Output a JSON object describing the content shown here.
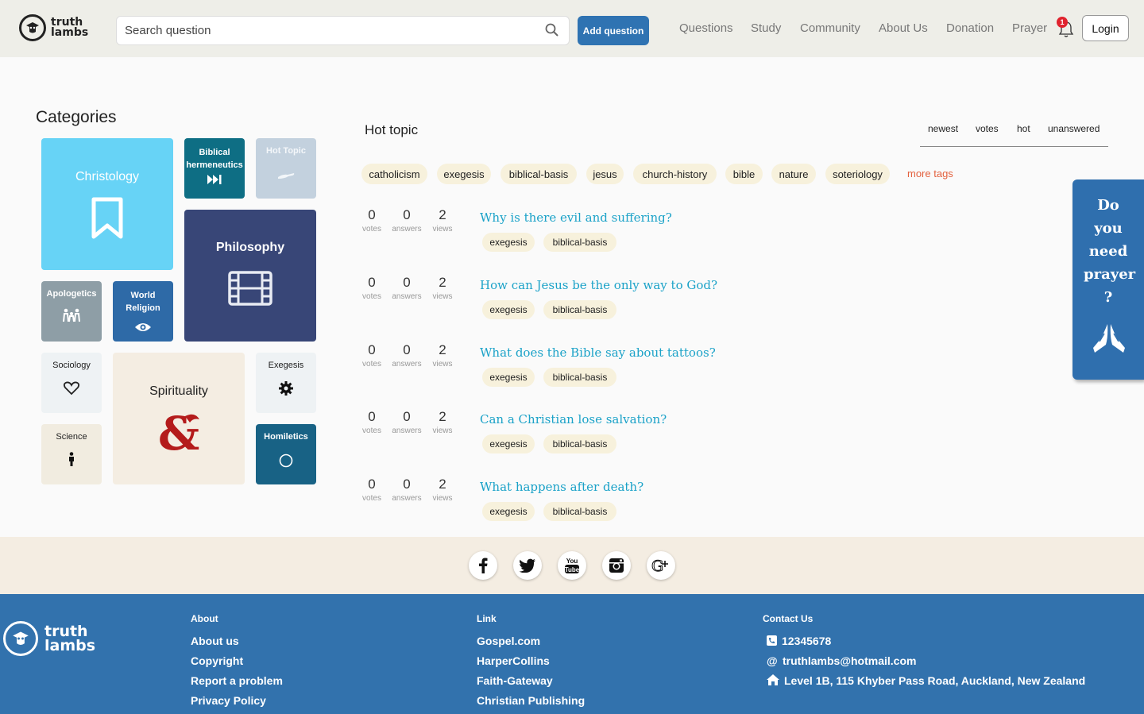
{
  "brand": {
    "line1": "truth",
    "line2": "lambs"
  },
  "search": {
    "placeholder": "Search question"
  },
  "header": {
    "add_question": "Add question",
    "nav": [
      "Questions",
      "Study",
      "Community",
      "About Us",
      "Donation",
      "Prayer"
    ],
    "notification_count": "1",
    "login": "Login"
  },
  "categories": {
    "title": "Categories",
    "tiles": [
      {
        "label": "Christology",
        "icon": "bookmark-icon",
        "color": "#67d3f6"
      },
      {
        "label": "Biblical hermeneutics",
        "icon": "fast-forward-icon",
        "color": "#0e6e84"
      },
      {
        "label": "Hot Topic",
        "icon": "hand-icon",
        "color": "#c3d1de"
      },
      {
        "label": "Philosophy",
        "icon": "film-icon",
        "color": "#384677"
      },
      {
        "label": "Apologetics",
        "icon": "people-icon",
        "color": "#8e9ea6"
      },
      {
        "label": "World Religion",
        "icon": "eye-icon",
        "color": "#2e6aa7"
      },
      {
        "label": "Sociology",
        "icon": "heart-icon",
        "color": "#eef2f4"
      },
      {
        "label": "Spirituality",
        "icon": "ampersand-dragon-icon",
        "color": "#f4ede2"
      },
      {
        "label": "Exegesis",
        "icon": "gear-icon",
        "color": "#eef2f4"
      },
      {
        "label": "Science",
        "icon": "person-icon",
        "color": "#f1ece0"
      },
      {
        "label": "Homiletics",
        "icon": "circle-icon",
        "color": "#186285"
      }
    ]
  },
  "hot": {
    "title": "Hot topic",
    "sort": [
      "newest",
      "votes",
      "hot",
      "unanswered"
    ],
    "tags": [
      "catholicism",
      "exegesis",
      "biblical-basis",
      "jesus",
      "church-history",
      "bible",
      "nature",
      "soteriology"
    ],
    "more_tags": "more tags"
  },
  "stat_labels": {
    "votes": "votes",
    "answers": "answers",
    "views": "views"
  },
  "questions": [
    {
      "title": "Why is there evil and suffering?",
      "votes": "0",
      "answers": "0",
      "views": "2",
      "tags": [
        "exegesis",
        "biblical-basis"
      ]
    },
    {
      "title": "How can Jesus be the only way to God?",
      "votes": "0",
      "answers": "0",
      "views": "2",
      "tags": [
        "exegesis",
        "biblical-basis"
      ]
    },
    {
      "title": "What does the Bible say about tattoos?",
      "votes": "0",
      "answers": "0",
      "views": "2",
      "tags": [
        "exegesis",
        "biblical-basis"
      ]
    },
    {
      "title": "Can a Christian lose salvation?",
      "votes": "0",
      "answers": "0",
      "views": "2",
      "tags": [
        "exegesis",
        "biblical-basis"
      ]
    },
    {
      "title": "What happens after death?",
      "votes": "0",
      "answers": "0",
      "views": "2",
      "tags": [
        "exegesis",
        "biblical-basis"
      ]
    }
  ],
  "prayer_widget": {
    "lines": [
      "Do",
      "you",
      "need",
      "prayer",
      "?"
    ],
    "icon": "praying-hands-icon"
  },
  "social": [
    "facebook-icon",
    "twitter-icon",
    "youtube-icon",
    "instagram-icon",
    "google-plus-icon"
  ],
  "footer": {
    "about": {
      "heading": "About",
      "items": [
        "About us",
        "Copyright",
        "Report a problem",
        "Privacy Policy"
      ]
    },
    "link": {
      "heading": "Link",
      "items": [
        "Gospel.com",
        "HarperCollins",
        "Faith-Gateway",
        "Christian Publishing"
      ]
    },
    "contact": {
      "heading": "Contact Us",
      "phone": "12345678",
      "email": "truthlambs@hotmail.com",
      "address": "Level 1B, 115 Khyber Pass Road, Auckland, New Zealand"
    }
  }
}
